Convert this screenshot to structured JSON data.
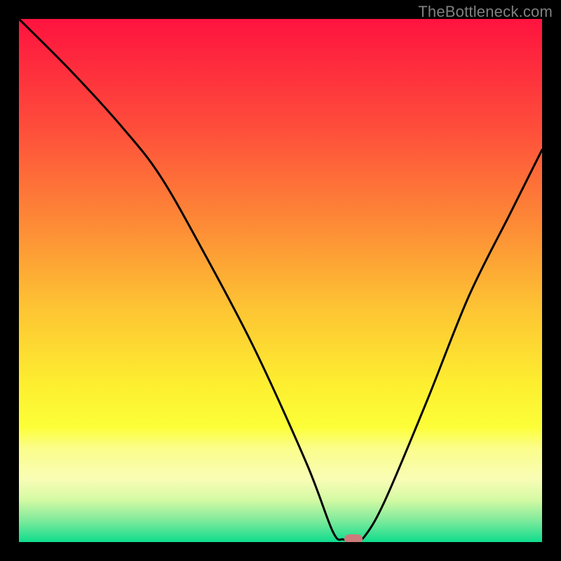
{
  "watermark": "TheBottleneck.com",
  "chart_data": {
    "type": "line",
    "title": "",
    "xlabel": "",
    "ylabel": "",
    "xlim": [
      0,
      100
    ],
    "ylim": [
      0,
      100
    ],
    "grid": false,
    "legend": false,
    "series": [
      {
        "name": "bottleneck-curve",
        "x": [
          0,
          10,
          20,
          27,
          35,
          45,
          55,
          60,
          62,
          64,
          66,
          70,
          78,
          86,
          94,
          100
        ],
        "values": [
          100,
          90,
          79,
          70,
          56,
          37,
          15,
          2,
          0.5,
          0.5,
          1,
          8,
          27,
          47,
          63,
          75
        ]
      }
    ],
    "marker": {
      "x": 64,
      "y": 0.5,
      "color": "#cd7a7b"
    },
    "gradient_stops": [
      {
        "offset": 0,
        "color": "#fe133f"
      },
      {
        "offset": 0.2,
        "color": "#fe4b3b"
      },
      {
        "offset": 0.4,
        "color": "#fd8d36"
      },
      {
        "offset": 0.55,
        "color": "#fdc333"
      },
      {
        "offset": 0.7,
        "color": "#fdef30"
      },
      {
        "offset": 0.78,
        "color": "#fcfe38"
      },
      {
        "offset": 0.82,
        "color": "#fbfd8a"
      },
      {
        "offset": 0.88,
        "color": "#f9fdb5"
      },
      {
        "offset": 0.92,
        "color": "#d3f9a3"
      },
      {
        "offset": 0.96,
        "color": "#7bea9b"
      },
      {
        "offset": 1.0,
        "color": "#0fdc8d"
      }
    ]
  }
}
